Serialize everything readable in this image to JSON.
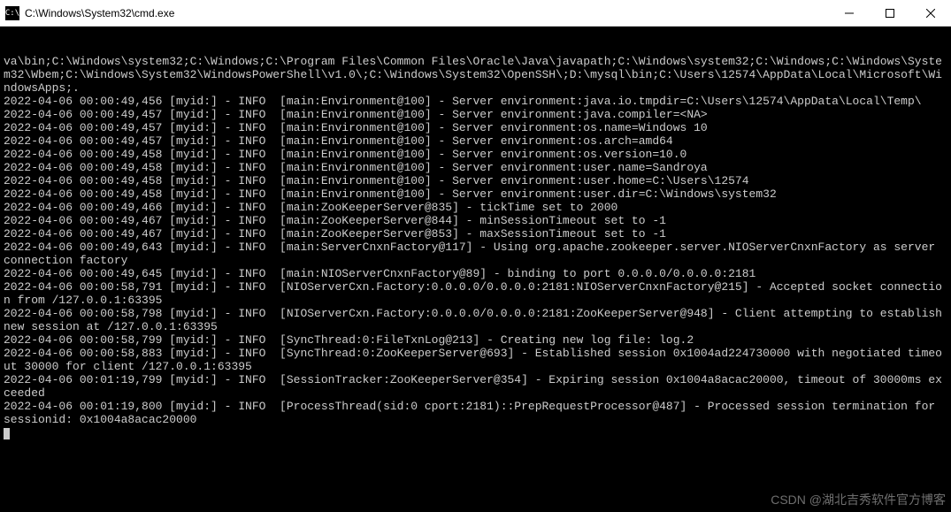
{
  "window": {
    "title": "C:\\Windows\\System32\\cmd.exe",
    "icon_label": "C:\\"
  },
  "terminal": {
    "lines": [
      "va\\bin;C:\\Windows\\system32;C:\\Windows;C:\\Program Files\\Common Files\\Oracle\\Java\\javapath;C:\\Windows\\system32;C:\\Windows;C:\\Windows\\System32\\Wbem;C:\\Windows\\System32\\WindowsPowerShell\\v1.0\\;C:\\Windows\\System32\\OpenSSH\\;D:\\mysql\\bin;C:\\Users\\12574\\AppData\\Local\\Microsoft\\WindowsApps;.",
      "2022-04-06 00:00:49,456 [myid:] - INFO  [main:Environment@100] - Server environment:java.io.tmpdir=C:\\Users\\12574\\AppData\\Local\\Temp\\",
      "2022-04-06 00:00:49,457 [myid:] - INFO  [main:Environment@100] - Server environment:java.compiler=<NA>",
      "2022-04-06 00:00:49,457 [myid:] - INFO  [main:Environment@100] - Server environment:os.name=Windows 10",
      "2022-04-06 00:00:49,457 [myid:] - INFO  [main:Environment@100] - Server environment:os.arch=amd64",
      "2022-04-06 00:00:49,458 [myid:] - INFO  [main:Environment@100] - Server environment:os.version=10.0",
      "2022-04-06 00:00:49,458 [myid:] - INFO  [main:Environment@100] - Server environment:user.name=Sandroya",
      "2022-04-06 00:00:49,458 [myid:] - INFO  [main:Environment@100] - Server environment:user.home=C:\\Users\\12574",
      "2022-04-06 00:00:49,458 [myid:] - INFO  [main:Environment@100] - Server environment:user.dir=C:\\Windows\\system32",
      "2022-04-06 00:00:49,466 [myid:] - INFO  [main:ZooKeeperServer@835] - tickTime set to 2000",
      "2022-04-06 00:00:49,467 [myid:] - INFO  [main:ZooKeeperServer@844] - minSessionTimeout set to -1",
      "2022-04-06 00:00:49,467 [myid:] - INFO  [main:ZooKeeperServer@853] - maxSessionTimeout set to -1",
      "2022-04-06 00:00:49,643 [myid:] - INFO  [main:ServerCnxnFactory@117] - Using org.apache.zookeeper.server.NIOServerCnxnFactory as server connection factory",
      "2022-04-06 00:00:49,645 [myid:] - INFO  [main:NIOServerCnxnFactory@89] - binding to port 0.0.0.0/0.0.0.0:2181",
      "2022-04-06 00:00:58,791 [myid:] - INFO  [NIOServerCxn.Factory:0.0.0.0/0.0.0.0:2181:NIOServerCnxnFactory@215] - Accepted socket connection from /127.0.0.1:63395",
      "2022-04-06 00:00:58,798 [myid:] - INFO  [NIOServerCxn.Factory:0.0.0.0/0.0.0.0:2181:ZooKeeperServer@948] - Client attempting to establish new session at /127.0.0.1:63395",
      "2022-04-06 00:00:58,799 [myid:] - INFO  [SyncThread:0:FileTxnLog@213] - Creating new log file: log.2",
      "2022-04-06 00:00:58,883 [myid:] - INFO  [SyncThread:0:ZooKeeperServer@693] - Established session 0x1004ad224730000 with negotiated timeout 30000 for client /127.0.0.1:63395",
      "2022-04-06 00:01:19,799 [myid:] - INFO  [SessionTracker:ZooKeeperServer@354] - Expiring session 0x1004a8acac20000, timeout of 30000ms exceeded",
      "2022-04-06 00:01:19,800 [myid:] - INFO  [ProcessThread(sid:0 cport:2181)::PrepRequestProcessor@487] - Processed session termination for sessionid: 0x1004a8acac20000"
    ]
  },
  "watermark": "CSDN @湖北吉秀软件官方博客"
}
